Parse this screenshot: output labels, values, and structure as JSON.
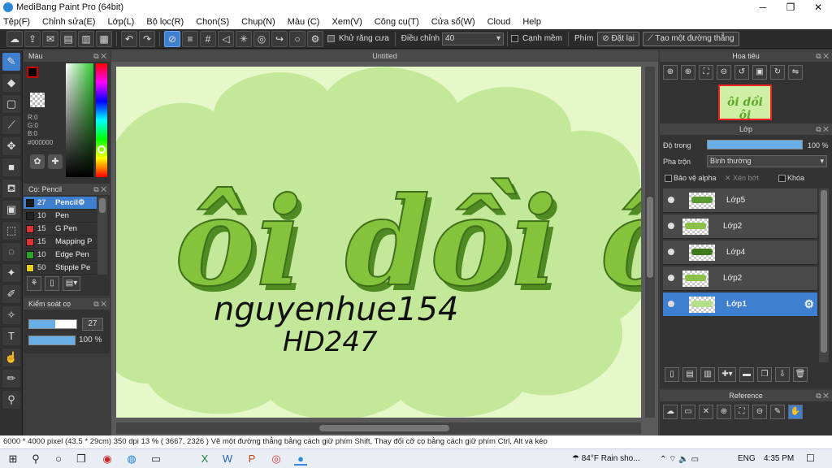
{
  "window": {
    "title": "MediBang Paint Pro (64bit)",
    "minimize": "─",
    "maximize": "❐",
    "close": "✕"
  },
  "menu": [
    "Tệp(F)",
    "Chỉnh sửa(E)",
    "Lớp(L)",
    "Bộ lọc(R)",
    "Chọn(S)",
    "Chụp(N)",
    "Màu (C)",
    "Xem(V)",
    "Công cụ(T)",
    "Cửa sổ(W)",
    "Cloud",
    "Help"
  ],
  "toolbar": {
    "antialias_label": "Khử răng cưa",
    "adjust_label": "Điều chỉnh",
    "adjust_value": "40",
    "soft_edge_label": "Cạnh mềm",
    "key_label": "Phím",
    "reset_label": "Đặt lại",
    "straight_line_label": "Tạo một đường thẳng"
  },
  "color_panel": {
    "title": "Màu",
    "r": "R:0",
    "g": "G:0",
    "b": "B:0",
    "hex": "#000000"
  },
  "brush_panel": {
    "title": "Cọ: Pencil",
    "items": [
      {
        "size": "27",
        "name": "Pencil",
        "color": "#1a1a1a",
        "selected": true
      },
      {
        "size": "10",
        "name": "Pen",
        "color": "#222222",
        "selected": false
      },
      {
        "size": "15",
        "name": "G Pen",
        "color": "#e03030",
        "selected": false
      },
      {
        "size": "15",
        "name": "Mapping P",
        "color": "#e03030",
        "selected": false
      },
      {
        "size": "10",
        "name": "Edge Pen",
        "color": "#29a329",
        "selected": false
      },
      {
        "size": "50",
        "name": "Stipple Pe",
        "color": "#e5d21a",
        "selected": false
      }
    ]
  },
  "control_panel": {
    "title": "Kiểm soát cọ",
    "size_value": "27",
    "opacity_value": "100 %",
    "size_fraction": 0.55,
    "opacity_fraction": 1.0
  },
  "canvas": {
    "doc_title": "Untitled",
    "art_title": "ôi dồi ôi",
    "signature_line1": "nguyenhue154",
    "signature_line2": "HD247"
  },
  "navigator": {
    "title": "Hoa tiêu"
  },
  "layers": {
    "title": "Lớp",
    "opacity_label": "Độ trong",
    "opacity_value": "100 %",
    "opacity_fraction": 1.0,
    "blend_label": "Pha trộn",
    "blend_value": "Bình thường",
    "protect_alpha": "Bảo vệ alpha",
    "clipping": "Xén bớt",
    "lock": "Khóa",
    "items": [
      {
        "name": "Lớp5",
        "selected": false
      },
      {
        "name": "Lớp2",
        "selected": false
      },
      {
        "name": "Lớp4",
        "selected": false
      },
      {
        "name": "Lớp2",
        "selected": false
      },
      {
        "name": "Lớp1",
        "selected": true
      }
    ]
  },
  "reference": {
    "title": "Reference"
  },
  "status": {
    "text": "6000 * 4000 pixel   (43.5 * 29cm)   350 dpi   13 %   ( 3667, 2326 )  Vẽ một đường thẳng bằng cách giữ phím Shift, Thay đổi cỡ cọ bằng cách giữ phím Ctrl, Alt và kéo"
  },
  "taskbar": {
    "weather": "84°F  Rain sho...",
    "lang": "ENG",
    "time": "4:35 PM"
  },
  "colors": {
    "accent": "#3f7fd0",
    "canvas_bg": "#e6f7c9",
    "cloud": "#c4e89a",
    "letter_main": "#86c33c",
    "letter_dark": "#4f8a22"
  }
}
